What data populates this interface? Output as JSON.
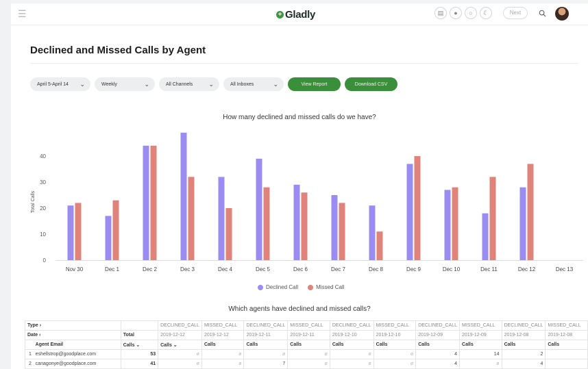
{
  "app": {
    "logo_text": "Gladly",
    "logo_mark": "+",
    "pill_button": "Next"
  },
  "top_icons": [
    "dashboard-icon",
    "people-icon",
    "chat-icon",
    "moon-icon"
  ],
  "page": {
    "title": "Declined and Missed Calls by Agent"
  },
  "filters": {
    "date_range": "April 5-April 14",
    "interval": "Weekly",
    "channels": "All Channels",
    "inboxes": "All Inboxes",
    "view_report": "View Report",
    "download_csv": "Download CSV"
  },
  "colors": {
    "declined": "#9b8cf2",
    "missed": "#e0837a",
    "primary_button": "#3a8f3a"
  },
  "chart_data": {
    "type": "bar",
    "title": "How many declined and missed calls do we have?",
    "ylabel": "Total Calls",
    "xlabel": "",
    "ylim": [
      0,
      50
    ],
    "yticks": [
      0,
      10,
      20,
      30,
      40
    ],
    "categories": [
      "Nov 30",
      "Dec 1",
      "Dec 2",
      "Dec 3",
      "Dec 4",
      "Dec 5",
      "Dec 6",
      "Dec 7",
      "Dec 8",
      "Dec 9",
      "Dec 10",
      "Dec 11",
      "Dec 12",
      "Dec 13"
    ],
    "series": [
      {
        "name": "Declined Call",
        "values": [
          21,
          17,
          44,
          49,
          32,
          39,
          29,
          25,
          21,
          37,
          27,
          18,
          28,
          0
        ]
      },
      {
        "name": "Missed Call",
        "values": [
          22,
          23,
          44,
          32,
          20,
          28,
          26,
          22,
          11,
          40,
          28,
          32,
          37,
          0
        ]
      }
    ],
    "legend": "bottom-center",
    "grid": false
  },
  "table": {
    "title": "Which agents have declined and missed calls?",
    "type_label": "Type",
    "date_label": "Date",
    "total_label": "Total",
    "agent_email_label": "Agent Email",
    "calls_sort_label": "Calls",
    "columns": [
      {
        "type": "DECLINED_CALL",
        "date": "2019-12-12"
      },
      {
        "type": "MISSED_CALL",
        "date": "2019-12-12"
      },
      {
        "type": "DECLINED_CALL",
        "date": "2019-12-11"
      },
      {
        "type": "MISSED_CALL",
        "date": "2019-12-11"
      },
      {
        "type": "DECLINED_CALL",
        "date": "2019-12-10"
      },
      {
        "type": "MISSED_CALL",
        "date": "2019-12-10"
      },
      {
        "type": "DECLINED_CALL",
        "date": "2019-12-09"
      },
      {
        "type": "MISSED_CALL",
        "date": "2019-12-09"
      },
      {
        "type": "DECLINED_CALL",
        "date": "2019-12-08"
      },
      {
        "type": "MISSED_CALL",
        "date": "2019-12-08"
      }
    ],
    "column_header_sorted": "Calls",
    "column_header": "Calls",
    "rows": [
      {
        "index": "1",
        "email": "eshellstrop@goodplace.com",
        "total": "53",
        "cells": [
          "ø",
          "ø",
          "ø",
          "ø",
          "ø",
          "ø",
          "4",
          "14",
          "2",
          ""
        ]
      },
      {
        "index": "2",
        "email": "canagonye@goodplace.com",
        "total": "41",
        "cells": [
          "ø",
          "ø",
          "7",
          "ø",
          "ø",
          "ø",
          "4",
          "ø",
          "4",
          ""
        ]
      }
    ]
  }
}
